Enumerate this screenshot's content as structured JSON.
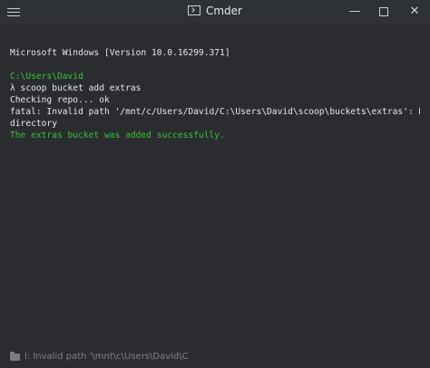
{
  "window": {
    "title": "Cmder"
  },
  "terminal": {
    "lines": [
      {
        "text": "Microsoft Windows [Version 10.0.16299.371]",
        "color": "#e8e8e8"
      },
      {
        "text": "",
        "color": "#e8e8e8"
      },
      {
        "text": "C:\\Users\\David",
        "color": "#39c436"
      },
      {
        "text": "λ scoop bucket add extras",
        "color": "#e8e8e8"
      },
      {
        "text": "Checking repo... ok",
        "color": "#e8e8e8"
      },
      {
        "text": "fatal: Invalid path '/mnt/c/Users/David/C:\\Users\\David\\scoop\\buckets\\extras': No such file or",
        "color": "#e8e8e8"
      },
      {
        "text": "directory",
        "color": "#e8e8e8"
      },
      {
        "text": "The extras bucket was added successfully.",
        "color": "#39c436"
      }
    ]
  },
  "statusbar": {
    "text": "l: Invalid path '\\mnt\\c\\Users\\David\\C"
  },
  "colors": {
    "background": "#2a2c30",
    "titlebar": "#2f3235",
    "text": "#e8e8e8",
    "prompt_green": "#39c436",
    "status_text": "#7f8388"
  },
  "icons": {
    "menu": "hamburger-menu-icon",
    "app": "terminal-app-icon",
    "minimize": "minimize-icon",
    "maximize": "maximize-icon",
    "close": "close-icon",
    "status": "folder-icon"
  }
}
